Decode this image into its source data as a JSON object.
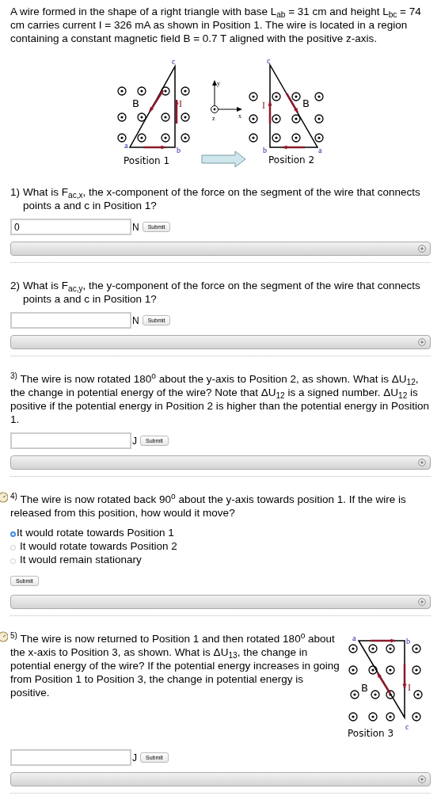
{
  "intro": "A wire formed in the shape of a right triangle with base L$_{ab}$ = 31 cm and height L$_{bc}$ = 74 cm carries current I = 326 mA as shown in Position 1. The wire is located in a region containing a constant magnetic field B = 0.7 T aligned with the positive z-axis.",
  "figure": {
    "position_1": {
      "caption": "Position 1",
      "a": "a",
      "b": "b",
      "c": "c",
      "field": "B",
      "current": "I"
    },
    "axes": {
      "x": "x",
      "y": "y",
      "z": "z"
    },
    "position_2": {
      "caption": "Position 2",
      "a": "a",
      "b": "b",
      "c": "c",
      "field": "B",
      "current": "I"
    }
  },
  "questions": [
    {
      "kind": "numeric",
      "number": "1)",
      "number_raised": false,
      "timer": false,
      "text": "What is F$_{ac,x}$, the x-component of the force on the segment of the wire that connects points a and c in Position 1?",
      "value": "0",
      "unit": "N",
      "submit": "Submit"
    },
    {
      "kind": "numeric",
      "number": "2)",
      "number_raised": false,
      "timer": false,
      "text": "What is F$_{ac,y}$, the y-component of the force on the segment of the wire that connects points a and c in Position 1?",
      "unit": "N",
      "submit": "Submit"
    },
    {
      "kind": "numeric",
      "number": "3)",
      "number_raised": true,
      "timer": false,
      "text": "The wire is now rotated 180$^{o}$ about the y-axis to Position 2, as shown. What is ΔU$_{12}$, the change in potential energy of the wire? Note that ΔU$_{12}$ is a signed number. ΔU$_{12}$ is positive if the potential energy in Position 2 is higher than the potential energy in Position 1.",
      "unit": "J",
      "submit": "Submit"
    },
    {
      "kind": "choice",
      "number": "4)",
      "number_raised": true,
      "timer": true,
      "text": "The wire is now rotated back 90$^{o}$ about the y-axis towards position 1. If the wire is released from this position, how would it move?",
      "options": [
        {
          "label": "It would rotate towards Position 1",
          "selected": true
        },
        {
          "label": "It would rotate towards Position 2",
          "selected": false
        },
        {
          "label": "It would remain stationary",
          "selected": false
        }
      ],
      "submit": "Submit"
    },
    {
      "kind": "numeric",
      "number": "5)",
      "number_raised": true,
      "timer": true,
      "text": "The wire is now returned to Position 1 and then rotated 180$^{o}$ about the x-axis to Position 3, as shown. What is ΔU$_{13}$, the change in potential energy of the wire? If the potential energy increases in going from Position 1 to Position 3, the change in potential energy is positive.",
      "figure": {
        "caption": "Position 3",
        "a": "a",
        "b": "b",
        "c": "c",
        "field": "B",
        "current": "I"
      },
      "unit": "J",
      "submit": "Submit"
    }
  ]
}
